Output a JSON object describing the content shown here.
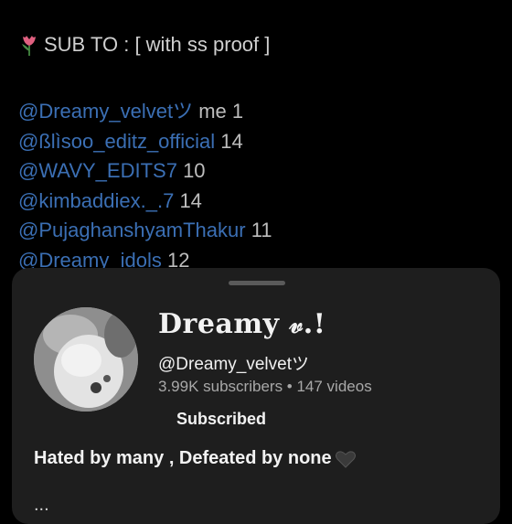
{
  "post": {
    "header_icon": "tulip-emoji",
    "header_text": "SUB TO : [ with ss proof ]",
    "mentions": [
      {
        "handle": "@Dreamy_velvetツ",
        "count": "me 1"
      },
      {
        "handle": "@ßlìsoo_editz_official",
        "count": "14"
      },
      {
        "handle": "@WAVY_EDITS7",
        "count": "10"
      },
      {
        "handle": "@kimbaddiex._.7",
        "count": "14"
      },
      {
        "handle": "@PujaghanshyamThakur",
        "count": "11"
      },
      {
        "handle": "@Dreamy_idols",
        "count": "12"
      }
    ]
  },
  "channel_card": {
    "name": "Dreamy 𝓋.!",
    "handle": "@Dreamy_velvetツ",
    "stats": "3.99K subscribers • 147 videos",
    "subscribe_label": "Subscribed",
    "bio": "Hated by many , Defeated by none",
    "bio_icon": "black-heart-emoji",
    "more": "..."
  },
  "colors": {
    "background": "#000000",
    "sheet": "#1e1e1e",
    "mention_link": "#3b6fb4",
    "text_primary": "#f2f2f2",
    "text_secondary": "#a8a8a8"
  }
}
